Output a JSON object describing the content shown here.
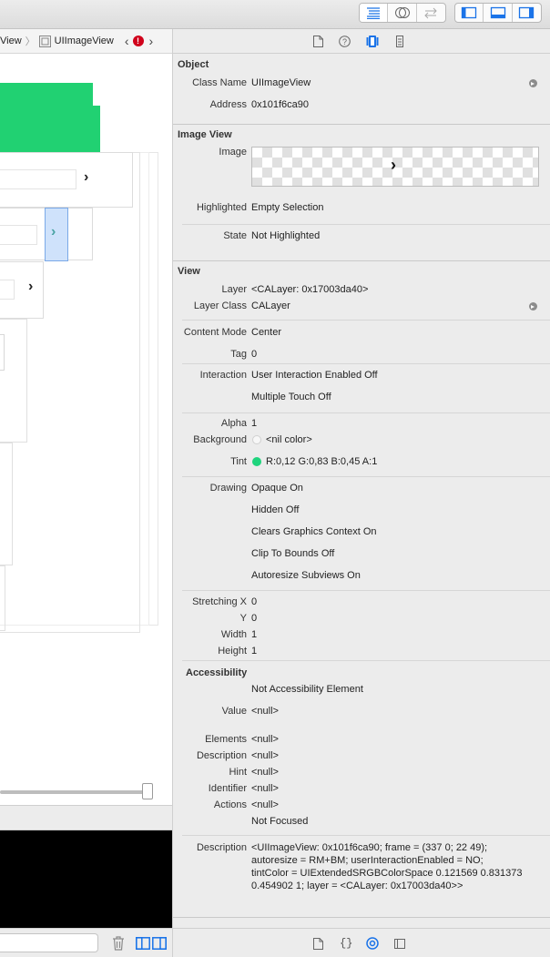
{
  "colors": {
    "tint": "#1fd47d",
    "canvas_green": "#21d172",
    "accent_blue": "#1a73e8",
    "error": "#d0021b"
  },
  "jumpbar": {
    "item1": "View",
    "item2": "UIImageView"
  },
  "inspector": {
    "object": {
      "title": "Object",
      "class_name_label": "Class Name",
      "class_name": "UIImageView",
      "address_label": "Address",
      "address": "0x101f6ca90"
    },
    "image_view": {
      "title": "Image View",
      "image_label": "Image",
      "highlighted_label": "Highlighted",
      "highlighted": "Empty Selection",
      "state_label": "State",
      "state": "Not Highlighted"
    },
    "view": {
      "title": "View",
      "layer_label": "Layer",
      "layer": "<CALayer: 0x17003da40>",
      "layer_class_label": "Layer Class",
      "layer_class": "CALayer",
      "content_mode_label": "Content Mode",
      "content_mode": "Center",
      "tag_label": "Tag",
      "tag": "0",
      "interaction_label": "Interaction",
      "interaction_1": "User Interaction Enabled Off",
      "interaction_2": "Multiple Touch Off",
      "alpha_label": "Alpha",
      "alpha": "1",
      "background_label": "Background",
      "background": "<nil color>",
      "tint_label": "Tint",
      "tint": "R:0,12 G:0,83 B:0,45 A:1",
      "drawing_label": "Drawing",
      "drawing_1": "Opaque On",
      "drawing_2": "Hidden Off",
      "drawing_3": "Clears Graphics Context On",
      "drawing_4": "Clip To Bounds Off",
      "drawing_5": "Autoresize Subviews On",
      "stretching_x_label": "Stretching X",
      "stretching_x": "0",
      "y_label": "Y",
      "y": "0",
      "width_label": "Width",
      "width": "1",
      "height_label": "Height",
      "height": "1"
    },
    "accessibility": {
      "title": "Accessibility",
      "element": "Not Accessibility Element",
      "value_label": "Value",
      "value": "<null>",
      "elements_label": "Elements",
      "elements": "<null>",
      "description_label": "Description",
      "description": "<null>",
      "hint_label": "Hint",
      "hint": "<null>",
      "identifier_label": "Identifier",
      "identifier": "<null>",
      "actions_label": "Actions",
      "actions": "<null>",
      "focused": "Not Focused"
    },
    "description": {
      "label": "Description",
      "line1": "<UIImageView: 0x101f6ca90; frame = (337 0; 22 49);",
      "line2": "autoresize = RM+BM; userInteractionEnabled = NO;",
      "line3": "tintColor = UIExtendedSRGBColorSpace 0.121569 0.831373",
      "line4": "0.454902 1; layer = <CALayer: 0x17003da40>>"
    }
  }
}
